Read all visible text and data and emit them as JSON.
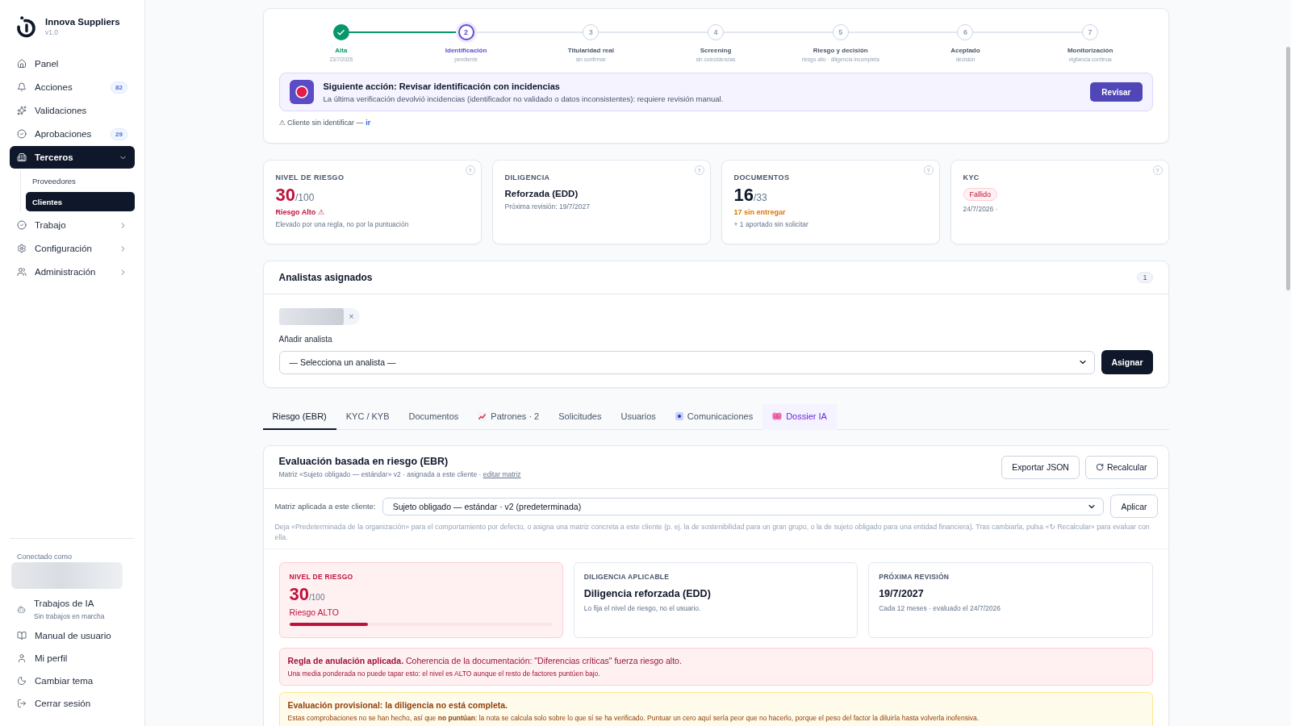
{
  "sidebar": {
    "brand": {
      "name": "Innova Suppliers",
      "version": "v1.0"
    },
    "nav": [
      {
        "label": "Panel",
        "selected": false
      },
      {
        "label": "Acciones",
        "badge": "82",
        "selected": false
      },
      {
        "label": "Validaciones",
        "selected": false
      },
      {
        "label": "Aprobaciones",
        "badge": "29",
        "selected": false
      },
      {
        "label": "Terceros",
        "selected": true,
        "expanded": true,
        "children": [
          {
            "label": "Proveedores",
            "selected": false
          },
          {
            "label": "Clientes",
            "selected": true
          }
        ]
      },
      {
        "label": "Trabajo",
        "selected": false,
        "expanded": false
      },
      {
        "label": "Configuración",
        "selected": false,
        "expanded": false
      },
      {
        "label": "Administración",
        "selected": false,
        "expanded": false
      }
    ],
    "footer": {
      "connected_label": "Conectado como",
      "jobs": {
        "title": "Trabajos de IA",
        "status": "Sin trabajos en marcha"
      },
      "links": [
        "Manual de usuario",
        "Mi perfil",
        "Cambiar tema",
        "Cerrar sesión"
      ]
    }
  },
  "stepper": {
    "steps": [
      {
        "label": "Alta",
        "sub": "23/7/2026",
        "done": true,
        "current": false
      },
      {
        "number": "2",
        "label": "Identificación",
        "sub": "pendiente",
        "done": false,
        "current": true
      },
      {
        "number": "3",
        "label": "Titularidad real",
        "sub": "sin confirmar",
        "done": false,
        "current": false
      },
      {
        "number": "4",
        "label": "Screening",
        "sub": "sin coincidencias",
        "done": false,
        "current": false
      },
      {
        "number": "5",
        "label": "Riesgo y decisión",
        "sub": "riesgo alto · diligencia incompleta",
        "done": false,
        "current": false
      },
      {
        "number": "6",
        "label": "Aceptado",
        "sub": "decisión",
        "done": false,
        "current": false
      },
      {
        "number": "7",
        "label": "Monitorización",
        "sub": "vigilancia continua",
        "done": false,
        "current": false
      }
    ],
    "next_action": {
      "title": "Siguiente acción: Revisar identificación con incidencias",
      "text": "La última verificación devolvió incidencias (identificador no validado o datos inconsistentes): requiere revisión manual.",
      "button": "Revisar"
    },
    "note": {
      "text": "⚠ Cliente sin identificar —",
      "link": "ir"
    }
  },
  "kpis": [
    {
      "kind": "score",
      "label": "NIVEL DE RIESGO",
      "help": "?",
      "value": "30",
      "total": "/100",
      "critical": true,
      "note": "Riesgo Alto ⚠",
      "color": "#be123c",
      "detail": "Elevado por una regla, no por la puntuación"
    },
    {
      "kind": "text",
      "label": "DILIGENCIA",
      "help": "?",
      "value": "Reforzada (EDD)",
      "detail": "Próxima revisión: 19/7/2027"
    },
    {
      "kind": "score",
      "label": "DOCUMENTOS",
      "help": "?",
      "value": "16",
      "total": "/33",
      "critical": false,
      "note": "17 sin entregar",
      "color": "#d97706",
      "detail": "+ 1 aportado sin solicitar"
    },
    {
      "kind": "badge",
      "label": "KYC",
      "help": "?",
      "value": "Fallido",
      "detail": "24/7/2026 ·"
    }
  ],
  "analysts": {
    "title": "Analistas asignados",
    "count": "1",
    "assigned": [
      {
        "remove": "×"
      }
    ],
    "add_label": "Añadir analista",
    "select": {
      "value": "— Selecciona un analista —"
    },
    "button": "Asignar"
  },
  "tabs": [
    {
      "label": "Riesgo (EBR)",
      "kind": "plain",
      "selected": true
    },
    {
      "label": "KYC / KYB",
      "kind": "plain",
      "selected": false
    },
    {
      "label": "Documentos",
      "kind": "plain",
      "selected": false
    },
    {
      "label": "Patrones · 2",
      "kind": "chart",
      "selected": false
    },
    {
      "label": "Solicitudes",
      "kind": "plain",
      "selected": false
    },
    {
      "label": "Usuarios",
      "kind": "plain",
      "selected": false
    },
    {
      "label": "Comunicaciones",
      "kind": "dot",
      "selected": false
    },
    {
      "label": "Dossier IA",
      "kind": "ai",
      "selected": false
    }
  ],
  "ebr": {
    "title": "Evaluación basada en riesgo (EBR)",
    "subtitle": "Matriz «Sujeto obligado — estándar» v2 · asignada a este cliente ·",
    "subtitle_link": "editar matriz",
    "buttons": [
      {
        "label": "Exportar JSON",
        "kind": "plain"
      },
      {
        "label": "Recalcular",
        "kind": "refresh"
      }
    ],
    "matrix": {
      "label": "Matriz aplicada a este cliente:",
      "value": "Sujeto obligado — estándar · v2 (predeterminada)",
      "button": "Aplicar",
      "help": "Deja «Predeterminada de la organización» para el comportamiento por defecto, o asigna una matriz concreta a este cliente (p. ej. la de sostenibilidad para un gran grupo, o la de sujeto obligado para una entidad financiera). Tras cambiarla, pulsa «↻ Recalcular» para evaluar con ella."
    },
    "summary": [
      {
        "kind": "risk",
        "label": "NIVEL DE RIESGO",
        "value": "30",
        "total": "/100",
        "note": "Riesgo ALTO",
        "level": 0.3
      },
      {
        "kind": "info",
        "label": "DILIGENCIA APLICABLE",
        "value": "Diligencia reforzada (EDD)",
        "detail": "Lo fija el nivel de riesgo, no el usuario."
      },
      {
        "kind": "info",
        "label": "PRÓXIMA REVISIÓN",
        "value": "19/7/2027",
        "detail": "Cada 12 meses · evaluado el 24/7/2026"
      }
    ],
    "alerts": [
      {
        "kind": "danger",
        "text": "**Regla de anulación aplicada.** Coherencia de la documentación: \"Diferencias críticas\" fuerza riesgo alto.",
        "detail": "Una media ponderada no puede tapar esto: el nivel es ALTO aunque el resto de factores puntúen bajo."
      },
      {
        "kind": "warning",
        "headline": "Evaluación provisional: la diligencia no está completa.",
        "detail": "Estas comprobaciones no se han hecho, así que **no puntúan**: la nota se calcula solo sobre lo que sí se ha verificado. Puntuar un cero aquí sería peor que no hacerlo, porque el peso del factor la diluiría hasta volverla inofensiva."
      }
    ]
  }
}
